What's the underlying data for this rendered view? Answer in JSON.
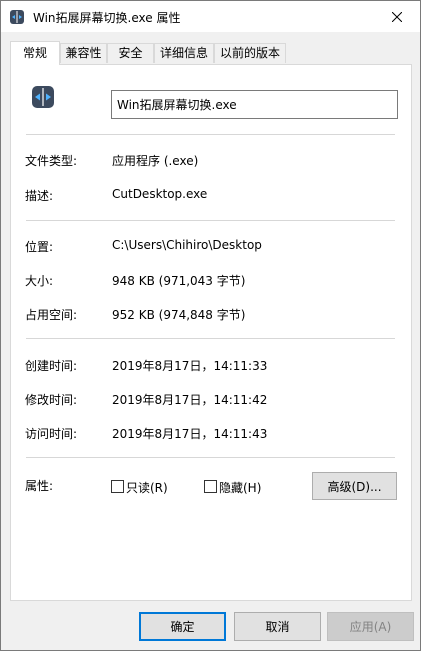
{
  "window": {
    "title": "Win拓展屏幕切换.exe 属性"
  },
  "tabs": [
    {
      "label": "常规"
    },
    {
      "label": "兼容性"
    },
    {
      "label": "安全"
    },
    {
      "label": "详细信息"
    },
    {
      "label": "以前的版本"
    }
  ],
  "general": {
    "filename": "Win拓展屏幕切换.exe",
    "file_type_label": "文件类型:",
    "file_type_value": "应用程序 (.exe)",
    "description_label": "描述:",
    "description_value": "CutDesktop.exe",
    "location_label": "位置:",
    "location_value": "C:\\Users\\Chihiro\\Desktop",
    "size_label": "大小:",
    "size_value": "948 KB (971,043 字节)",
    "size_on_disk_label": "占用空间:",
    "size_on_disk_value": "952 KB (974,848 字节)",
    "created_label": "创建时间:",
    "created_value": "2019年8月17日，14:11:33",
    "modified_label": "修改时间:",
    "modified_value": "2019年8月17日，14:11:42",
    "accessed_label": "访问时间:",
    "accessed_value": "2019年8月17日，14:11:43",
    "attributes_label": "属性:",
    "readonly_label": "只读(R)",
    "readonly_checked": false,
    "hidden_label": "隐藏(H)",
    "hidden_checked": false,
    "advanced_label": "高级(D)..."
  },
  "buttons": {
    "ok": "确定",
    "cancel": "取消",
    "apply": "应用(A)"
  },
  "colors": {
    "focus_border": "#0078d7",
    "app_icon_bg": "#3c4a5e",
    "app_icon_accent": "#4fb3ff"
  }
}
